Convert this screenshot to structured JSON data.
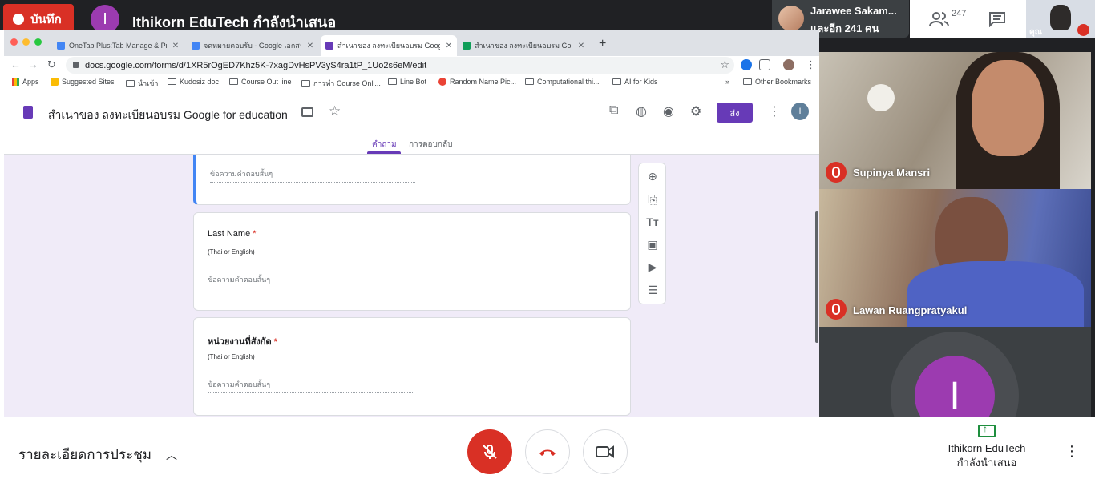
{
  "meet": {
    "recording_label": "บันทึก",
    "presenter_initial": "I",
    "presenter_title": "Ithikorn EduTech กำลังนำเสนอ",
    "participant_chip": {
      "name": "Jarawee Sakam...",
      "others": "และอีก 241 คน"
    },
    "people_count": "247",
    "self_label": "คุณ"
  },
  "browser": {
    "tabs": [
      {
        "title": "OneTab Plus:Tab Manage & Pr",
        "icon_color": "#4285f4"
      },
      {
        "title": "จดหมายตอบรับ - Google เอกสาร",
        "icon_color": "#4285f4"
      },
      {
        "title": "สำเนาของ ลงทะเบียนอบรม Google",
        "icon_color": "#673ab7"
      },
      {
        "title": "สำเนาของ ลงทะเบียนอบรม Google",
        "icon_color": "#0f9d58"
      }
    ],
    "url": "docs.google.com/forms/d/1XR5rOgED7Khz5K-7xagDvHsPV3yS4ra1tP_1Uo2s6eM/edit",
    "bookmarks": [
      "Apps",
      "Suggested Sites",
      "นำเข้า",
      "Kudosiz doc",
      "Course Out line",
      "การทำ Course Onli...",
      "Line Bot",
      "Random Name Pic...",
      "Computational thi...",
      "AI for Kids"
    ],
    "bookmarks_overflow": "»",
    "other_bookmarks": "Other Bookmarks"
  },
  "form": {
    "title": "สำเนาของ ลงทะเบียนอบรม Google for education",
    "send_label": "ส่ง",
    "account_initial": "I",
    "tabs": {
      "questions": "คำถาม",
      "responses": "การตอบกลับ"
    },
    "questions": [
      {
        "answer_placeholder": "ข้อความคำตอบสั้นๆ"
      },
      {
        "title": "Last Name",
        "required": "*",
        "description": "(Thai or English)",
        "answer_placeholder": "ข้อความคำตอบสั้นๆ"
      },
      {
        "title": "หน่วยงานที่สังกัด",
        "required": "*",
        "description": "(Thai or English)",
        "answer_placeholder": "ข้อความคำตอบสั้นๆ"
      }
    ]
  },
  "participants": [
    {
      "name": "Supinya Mansri"
    },
    {
      "name": "Lawan Ruangpratyakul"
    },
    {
      "initial": "I"
    }
  ],
  "bottom": {
    "meeting_details": "รายละเอียดการประชุม",
    "presenting_name": "Ithikorn EduTech",
    "presenting_status": "กำลังนำเสนอ"
  },
  "colors": {
    "accent_purple": "#673ab7",
    "avatar_purple": "#9c3bb0",
    "danger_red": "#d93025",
    "present_green": "#1e8e3e"
  }
}
